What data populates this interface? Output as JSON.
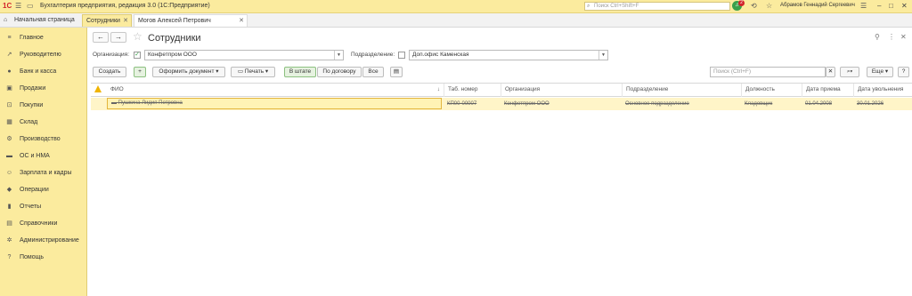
{
  "titlebar": {
    "logo": "1С",
    "app_title": "Бухгалтерия предприятия, редакция 3.0  (1С:Предприятие)",
    "search_placeholder": "Поиск Ctrl+Shift+F",
    "notifications_count": "2",
    "user_name": "Абрамов Геннадий Сергеевич"
  },
  "tabs": [
    {
      "label": "Начальная страница"
    },
    {
      "label": "Сотрудники"
    },
    {
      "label": "Могов Алексей Петрович (Сотрудник)"
    }
  ],
  "sidebar": {
    "items": [
      {
        "label": "Главное",
        "icon": "menu-icon"
      },
      {
        "label": "Руководителю",
        "icon": "trend-icon"
      },
      {
        "label": "Банк и касса",
        "icon": "coin-icon"
      },
      {
        "label": "Продажи",
        "icon": "bag-icon"
      },
      {
        "label": "Покупки",
        "icon": "cart-icon"
      },
      {
        "label": "Склад",
        "icon": "warehouse-icon"
      },
      {
        "label": "Производство",
        "icon": "factory-icon"
      },
      {
        "label": "ОС и НМА",
        "icon": "truck-icon"
      },
      {
        "label": "Зарплата и кадры",
        "icon": "people-icon"
      },
      {
        "label": "Операции",
        "icon": "operations-icon"
      },
      {
        "label": "Отчеты",
        "icon": "chart-icon"
      },
      {
        "label": "Справочники",
        "icon": "book-icon"
      },
      {
        "label": "Администрирование",
        "icon": "gear-icon"
      },
      {
        "label": "Помощь",
        "icon": "question-icon"
      }
    ]
  },
  "page": {
    "title": "Сотрудники"
  },
  "filters": {
    "org_label": "Организация:",
    "org_value": "Конфетпром ООО",
    "dept_label": "Подразделение:",
    "dept_value": "Доп.офис Каменская"
  },
  "toolbar": {
    "create": "Создать",
    "document": "Оформить документ",
    "print": "Печать",
    "seg_staff": "В штате",
    "seg_contract": "По договору",
    "seg_all": "Все",
    "search_placeholder": "Поиск (Ctrl+F)",
    "more": "Еще",
    "help": "?"
  },
  "table": {
    "columns": [
      "ФИО",
      "Таб. номер",
      "Организация",
      "Подразделение",
      "Должность",
      "Дата приема",
      "Дата увольнения"
    ],
    "rows": [
      {
        "fio": "Пушкина Лидия Петровна",
        "tab": "КП00-00007",
        "org": "Конфетпром ООО",
        "dept": "Основное подразделение",
        "pos": "Кладовщик",
        "hire": "01.04.2008",
        "fire": "30.01.2026"
      }
    ]
  },
  "colors": {
    "accent": "#fbeb9e",
    "brand_red": "#d2232a",
    "selection_row": "#fff5c8"
  }
}
